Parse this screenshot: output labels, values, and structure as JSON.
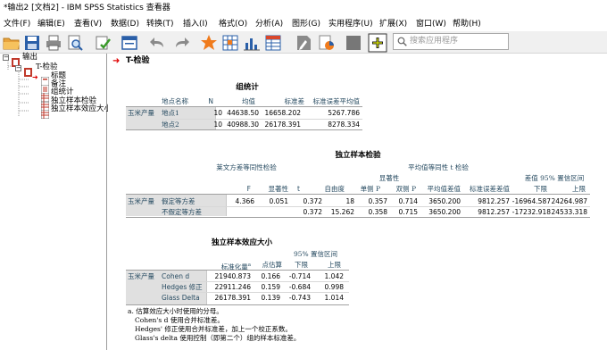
{
  "window": {
    "title": "*输出2 [文档2] - IBM SPSS Statistics 查看器"
  },
  "menu": [
    "文件(F)",
    "编辑(E)",
    "查看(V)",
    "数据(D)",
    "转换(T)",
    "插入(I)",
    "格式(O)",
    "分析(A)",
    "图形(G)",
    "实用程序(U)",
    "扩展(X)",
    "窗口(W)",
    "帮助(H)"
  ],
  "search": {
    "placeholder": "搜索应用程序"
  },
  "toolbar": {
    "icons": [
      "open-folder-icon",
      "save-icon",
      "print-icon",
      "print-preview-icon",
      "export-icon",
      "recall-dialog-icon",
      "undo-icon",
      "redo-icon",
      "goto-data-icon",
      "goto-variable-icon",
      "variables-icon",
      "output-icon",
      "designate-icon",
      "chart-icon",
      "select-cases-icon",
      "insert-title-icon"
    ]
  },
  "nav": {
    "items": [
      "输出",
      "T-检验",
      "标题",
      "备注",
      "组统计",
      "独立样本检验",
      "独立样本效应大小"
    ]
  },
  "output": {
    "heading": "T-检验",
    "group_stats": {
      "title": "组统计",
      "headers": [
        "地点名称",
        "N",
        "均值",
        "标准差",
        "标准误差平均值"
      ],
      "row_label": "玉米产量",
      "rows": [
        [
          "地点1",
          "10",
          "44638.50",
          "16658.202",
          "5267.786"
        ],
        [
          "地点2",
          "10",
          "40988.30",
          "26178.391",
          "8278.334"
        ]
      ]
    },
    "ind_test": {
      "title": "独立样本检验",
      "levene": "莱文方差等同性检验",
      "ttest": "平均值等同性 t 检验",
      "sig_group": "显著性",
      "ci_group": "差值 95% 置信区间",
      "headers": [
        "F",
        "显著性",
        "t",
        "自由度",
        "单侧 P",
        "双侧 P",
        "平均值差值",
        "标准误差差值",
        "下限",
        "上限"
      ],
      "row_label": "玉米产量",
      "rows": [
        {
          "label": "假定等方差",
          "values": [
            "4.366",
            "0.051",
            "0.372",
            "18",
            "0.357",
            "0.714",
            "3650.200",
            "9812.257",
            "-16964.587",
            "24264.987"
          ]
        },
        {
          "label": "不假定等方差",
          "values": [
            "",
            "",
            "0.372",
            "15.262",
            "0.358",
            "0.715",
            "3650.200",
            "9812.257",
            "-17232.918",
            "24533.318"
          ]
        }
      ]
    },
    "effect": {
      "title": "独立样本效应大小",
      "headers": [
        "标准化量",
        "点估算",
        "下限",
        "上限"
      ],
      "superscript": "a",
      "ci_group": "95% 置信区间",
      "row_label": "玉米产量",
      "rows": [
        [
          "Cohen d",
          "21940.873",
          "0.166",
          "-0.714",
          "1.042"
        ],
        [
          "Hedges 修正",
          "22911.246",
          "0.159",
          "-0.684",
          "0.998"
        ],
        [
          "Glass Delta",
          "26178.391",
          "0.139",
          "-0.743",
          "1.014"
        ]
      ],
      "footnotes": [
        "a. 估算效应大小时使用的分母。",
        "Cohen's d 使用合并标准差。",
        "Hedges' 修正使用合并标准差，加上一个校正系数。",
        "Glass's delta 使用控制（即第二个）组的样本标准差。"
      ]
    }
  }
}
